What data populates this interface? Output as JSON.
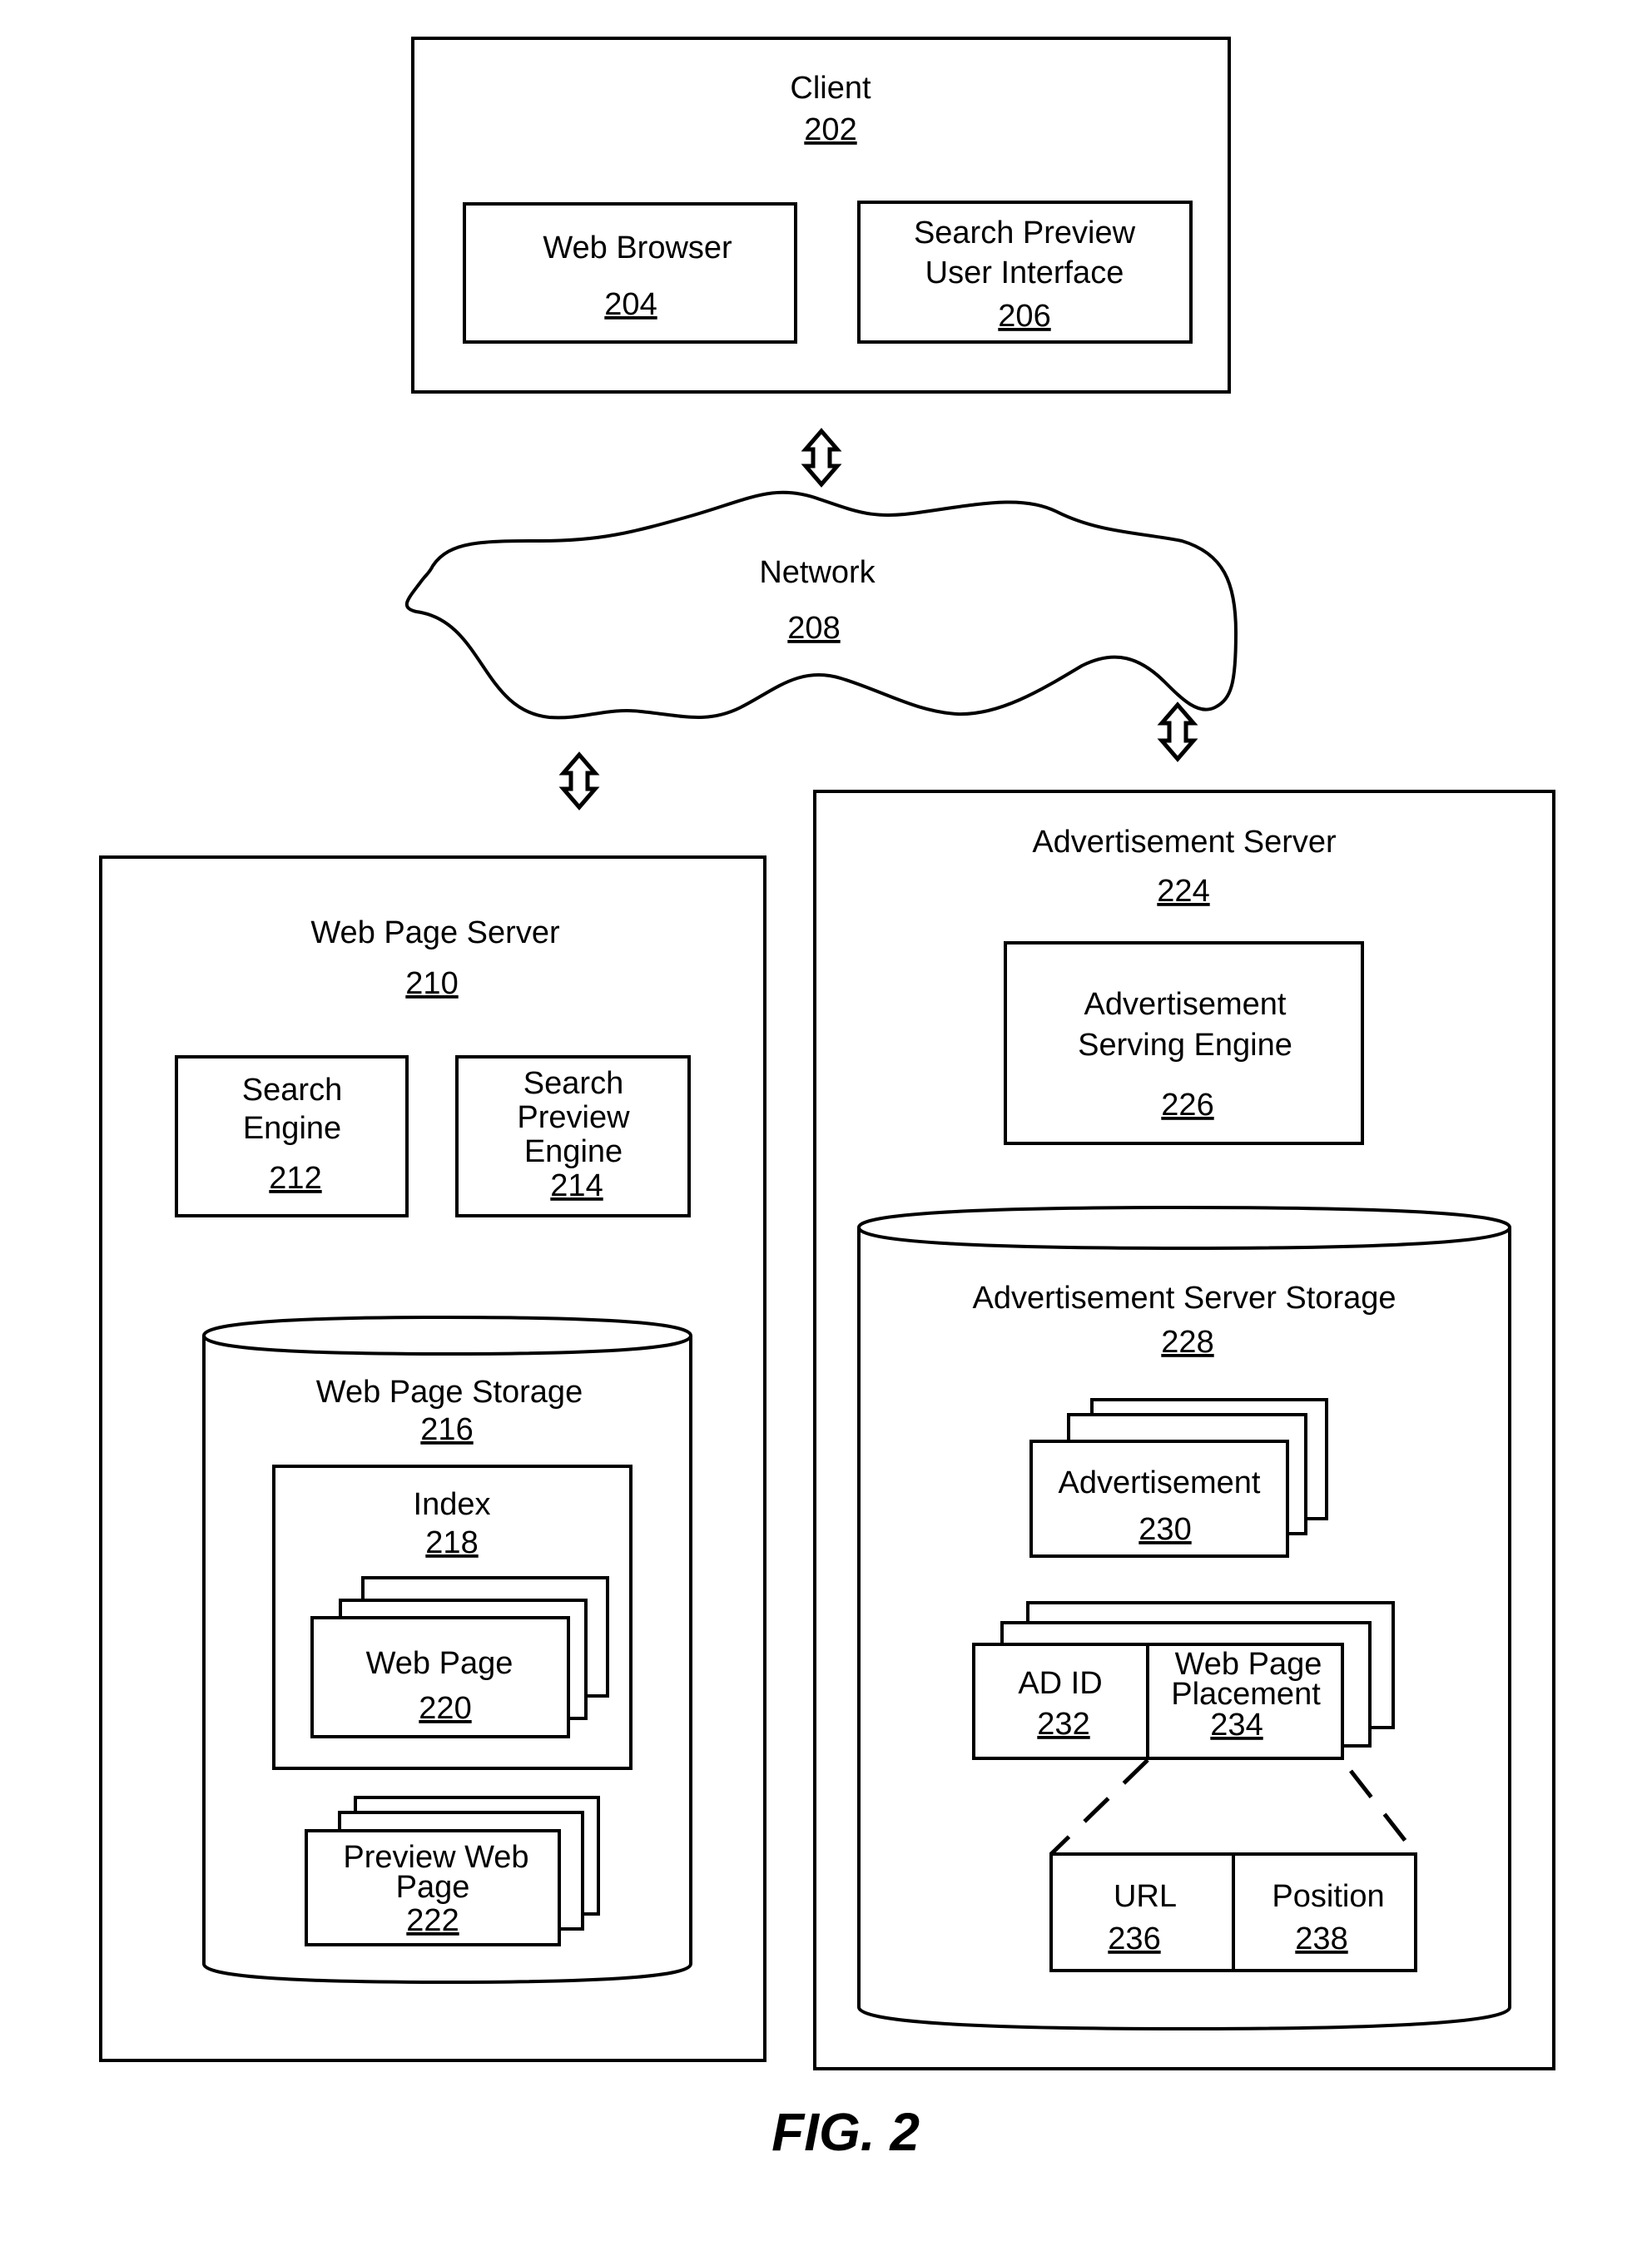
{
  "figure": {
    "caption": "FIG. 2"
  },
  "client": {
    "title": "Client",
    "ref": "202",
    "web_browser": {
      "title": "Web Browser",
      "ref": "204"
    },
    "search_preview_ui": {
      "lines": [
        "Search Preview",
        "User Interface"
      ],
      "ref": "206"
    }
  },
  "network": {
    "title": "Network",
    "ref": "208"
  },
  "web_page_server": {
    "title": "Web Page Server",
    "ref": "210",
    "search_engine": {
      "lines": [
        "Search",
        "Engine"
      ],
      "ref": "212"
    },
    "search_preview_engine": {
      "lines": [
        "Search",
        "Preview",
        "Engine"
      ],
      "ref": "214"
    },
    "storage": {
      "title": "Web Page Storage",
      "ref": "216",
      "index": {
        "title": "Index",
        "ref": "218",
        "web_page": {
          "title": "Web Page",
          "ref": "220"
        }
      },
      "preview_web_page": {
        "lines": [
          "Preview Web",
          "Page"
        ],
        "ref": "222"
      }
    }
  },
  "ad_server": {
    "title": "Advertisement Server",
    "ref": "224",
    "serving_engine": {
      "lines": [
        "Advertisement",
        "Serving Engine"
      ],
      "ref": "226"
    },
    "storage": {
      "title": "Advertisement Server Storage",
      "ref": "228",
      "advertisement": {
        "title": "Advertisement",
        "ref": "230"
      },
      "ad_id": {
        "title": "AD ID",
        "ref": "232"
      },
      "placement": {
        "lines": [
          "Web Page",
          "Placement"
        ],
        "ref": "234"
      },
      "url": {
        "title": "URL",
        "ref": "236"
      },
      "position": {
        "title": "Position",
        "ref": "238"
      }
    }
  }
}
